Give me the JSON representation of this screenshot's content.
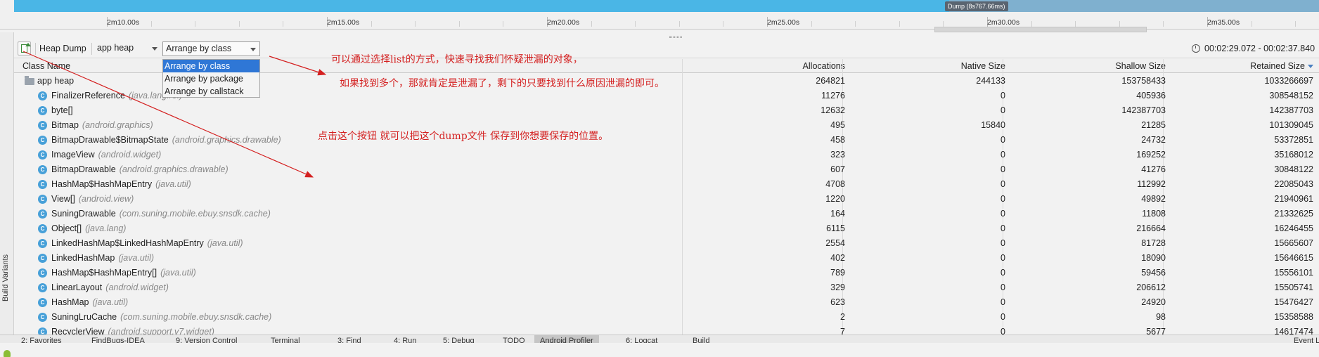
{
  "timeline": {
    "ticks": [
      "2m10.00s",
      "2m15.00s",
      "2m20.00s",
      "2m25.00s",
      "2m30.00s",
      "2m35.00s"
    ],
    "dump_label": "Dump (8s767.66ms)"
  },
  "toolbar": {
    "heap_dump_label": "Heap Dump",
    "heap_select": "app heap",
    "arrange_select": "Arrange by class",
    "time_range": "00:02:29.072 - 00:02:37.840"
  },
  "arrange_menu": {
    "options": [
      "Arrange by class",
      "Arrange by package",
      "Arrange by callstack"
    ],
    "selected": "Arrange by class"
  },
  "table": {
    "headers": {
      "class_name": "Class Name",
      "allocations": "Allocations",
      "native_size": "Native Size",
      "shallow_size": "Shallow Size",
      "retained_size": "Retained Size"
    },
    "root": {
      "name": "app heap",
      "allocations": "264821",
      "native": "244133",
      "shallow": "153758433",
      "retained": "1033266697"
    },
    "rows": [
      {
        "name": "FinalizerReference",
        "pkg": "(java.lang.ref)",
        "allocations": "11276",
        "native": "0",
        "shallow": "405936",
        "retained": "308548152"
      },
      {
        "name": "byte[]",
        "pkg": "",
        "allocations": "12632",
        "native": "0",
        "shallow": "142387703",
        "retained": "142387703"
      },
      {
        "name": "Bitmap",
        "pkg": "(android.graphics)",
        "allocations": "495",
        "native": "15840",
        "shallow": "21285",
        "retained": "101309045"
      },
      {
        "name": "BitmapDrawable$BitmapState",
        "pkg": "(android.graphics.drawable)",
        "allocations": "458",
        "native": "0",
        "shallow": "24732",
        "retained": "53372851"
      },
      {
        "name": "ImageView",
        "pkg": "(android.widget)",
        "allocations": "323",
        "native": "0",
        "shallow": "169252",
        "retained": "35168012"
      },
      {
        "name": "BitmapDrawable",
        "pkg": "(android.graphics.drawable)",
        "allocations": "607",
        "native": "0",
        "shallow": "41276",
        "retained": "30848122"
      },
      {
        "name": "HashMap$HashMapEntry",
        "pkg": "(java.util)",
        "allocations": "4708",
        "native": "0",
        "shallow": "112992",
        "retained": "22085043"
      },
      {
        "name": "View[]",
        "pkg": "(android.view)",
        "allocations": "1220",
        "native": "0",
        "shallow": "49892",
        "retained": "21940961"
      },
      {
        "name": "SuningDrawable",
        "pkg": "(com.suning.mobile.ebuy.snsdk.cache)",
        "allocations": "164",
        "native": "0",
        "shallow": "11808",
        "retained": "21332625"
      },
      {
        "name": "Object[]",
        "pkg": "(java.lang)",
        "allocations": "6115",
        "native": "0",
        "shallow": "216664",
        "retained": "16246455"
      },
      {
        "name": "LinkedHashMap$LinkedHashMapEntry",
        "pkg": "(java.util)",
        "allocations": "2554",
        "native": "0",
        "shallow": "81728",
        "retained": "15665607"
      },
      {
        "name": "LinkedHashMap",
        "pkg": "(java.util)",
        "allocations": "402",
        "native": "0",
        "shallow": "18090",
        "retained": "15646615"
      },
      {
        "name": "HashMap$HashMapEntry[]",
        "pkg": "(java.util)",
        "allocations": "789",
        "native": "0",
        "shallow": "59456",
        "retained": "15556101"
      },
      {
        "name": "LinearLayout",
        "pkg": "(android.widget)",
        "allocations": "329",
        "native": "0",
        "shallow": "206612",
        "retained": "15505741"
      },
      {
        "name": "HashMap",
        "pkg": "(java.util)",
        "allocations": "623",
        "native": "0",
        "shallow": "24920",
        "retained": "15476427"
      },
      {
        "name": "SuningLruCache",
        "pkg": "(com.suning.mobile.ebuy.snsdk.cache)",
        "allocations": "2",
        "native": "0",
        "shallow": "98",
        "retained": "15358588"
      },
      {
        "name": "RecyclerView",
        "pkg": "(android.support.v7.widget)",
        "allocations": "7",
        "native": "0",
        "shallow": "5677",
        "retained": "14617474"
      }
    ]
  },
  "annotations": {
    "note1": "可以通过选择list的方式，快速寻找我们怀疑泄漏的对象，",
    "note2": "如果找到多个，那就肯定是泄漏了，剩下的只要找到什么原因泄漏的即可。",
    "note3": "点击这个按钮 就可以把这个dump文件 保存到你想要保存的位置。",
    "color": "#d42020"
  },
  "left_strip": {
    "label": "Build Variants"
  },
  "bottom_bar": {
    "items": [
      "2: Favorites",
      "FindBugs-IDEA",
      "9: Version Control",
      "Terminal",
      "3: Find",
      "4: Run",
      "5: Debug",
      "TODO",
      "Android Profiler",
      "6: Logcat",
      "Build",
      "Event Log"
    ],
    "active": "Android Profiler"
  }
}
